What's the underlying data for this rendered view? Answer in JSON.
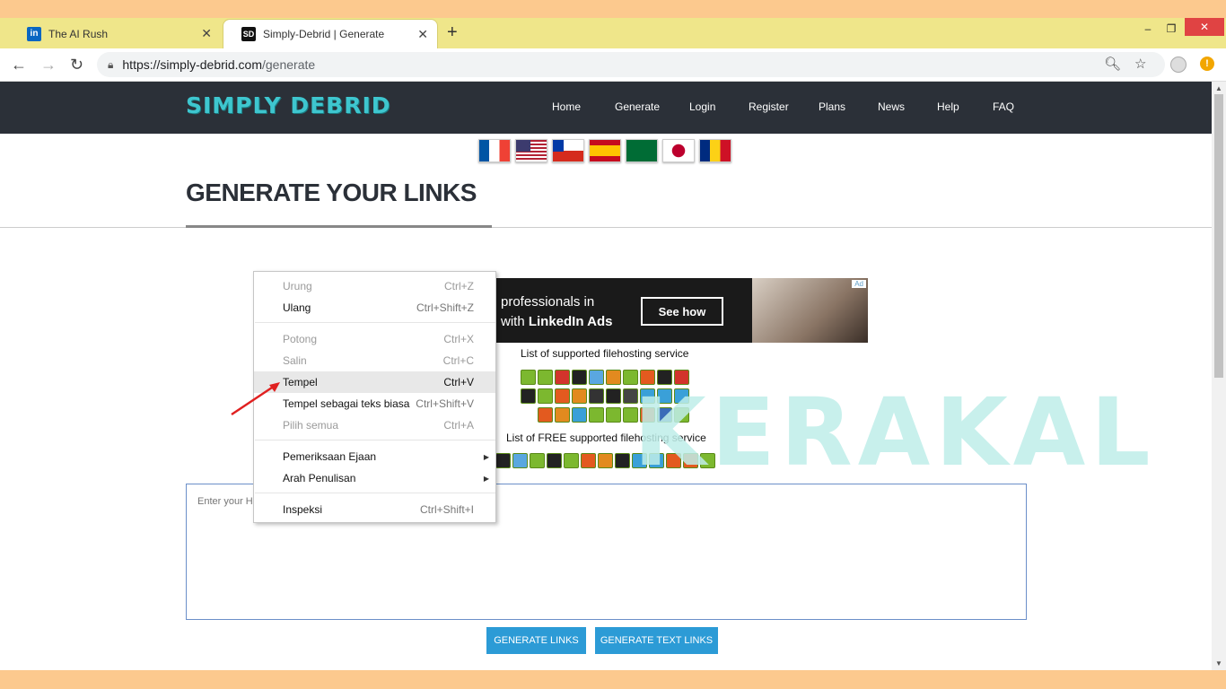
{
  "browser": {
    "tabs": [
      {
        "title": "The AI Rush",
        "favicon": "in",
        "active": false
      },
      {
        "title": "Simply-Debrid | Generate",
        "favicon": "SD",
        "active": true
      }
    ],
    "new_tab": "+",
    "url_host": "https://simply-debrid.com",
    "url_path": "/generate",
    "window": {
      "min": "–",
      "max": "❐",
      "close": "✕"
    }
  },
  "site": {
    "logo": "SIMPLY DEBRID",
    "nav": [
      "Home",
      "Generate",
      "Login",
      "Register",
      "Plans",
      "News",
      "Help",
      "FAQ"
    ],
    "page_title": "GENERATE YOUR LINKS",
    "ad": {
      "line1": "professionals in",
      "line2_prefix": "with ",
      "line2_bold": "LinkedIn Ads",
      "cta": "See how",
      "badge": "Ad"
    },
    "supported_title": "List of supported filehosting service",
    "free_title": "List of FREE supported filehosting service",
    "textarea_placeholder": "Enter your HT",
    "generate_links": "GENERATE LINKS",
    "generate_text_links": "GENERATE TEXT LINKS",
    "watermark": "KERAKAL"
  },
  "context_menu": {
    "items": [
      {
        "label": "Urung",
        "shortcut": "Ctrl+Z",
        "enabled": false
      },
      {
        "label": "Ulang",
        "shortcut": "Ctrl+Shift+Z",
        "enabled": true
      },
      {
        "label": "Potong",
        "shortcut": "Ctrl+X",
        "enabled": false
      },
      {
        "label": "Salin",
        "shortcut": "Ctrl+C",
        "enabled": false
      },
      {
        "label": "Tempel",
        "shortcut": "Ctrl+V",
        "enabled": true,
        "highlighted": true
      },
      {
        "label": "Tempel sebagai teks biasa",
        "shortcut": "Ctrl+Shift+V",
        "enabled": true
      },
      {
        "label": "Pilih semua",
        "shortcut": "Ctrl+A",
        "enabled": false
      },
      {
        "label": "Pemeriksaan Ejaan",
        "submenu": true,
        "enabled": true
      },
      {
        "label": "Arah Penulisan",
        "submenu": true,
        "enabled": true
      },
      {
        "label": "Inspeksi",
        "shortcut": "Ctrl+Shift+I",
        "enabled": true
      }
    ]
  },
  "colors": {
    "header_bg": "#2b3038",
    "logo": "#3ec6cf",
    "button": "#2c9bd6",
    "icon_green": "#7cb82f"
  }
}
